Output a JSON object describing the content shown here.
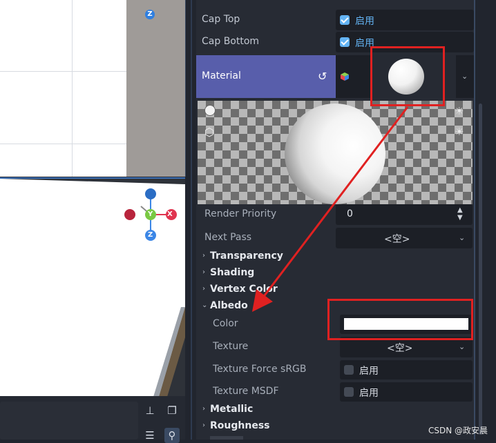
{
  "inspector": {
    "cap_top": {
      "label": "Cap Top",
      "value": "启用",
      "checked": true
    },
    "cap_bottom": {
      "label": "Cap Bottom",
      "value": "启用",
      "checked": true
    },
    "material": {
      "label": "Material",
      "reset_icon": "reset-icon",
      "type_icon": "cube-icon"
    },
    "render_priority": {
      "label": "Render Priority",
      "value": "0"
    },
    "next_pass": {
      "label": "Next Pass",
      "value": "<空>"
    },
    "sections": {
      "transparency": "Transparency",
      "shading": "Shading",
      "vertex_color": "Vertex Color",
      "albedo": "Albedo",
      "metallic": "Metallic",
      "roughness": "Roughness"
    },
    "albedo": {
      "color": {
        "label": "Color",
        "value_color": "#ffffff"
      },
      "texture": {
        "label": "Texture",
        "value": "<空>"
      },
      "texture_force_srgb": {
        "label": "Texture Force sRGB",
        "value": "启用",
        "checked": false
      },
      "texture_msdf": {
        "label": "Texture MSDF",
        "value": "启用",
        "checked": false
      }
    }
  },
  "viewport": {
    "gizmo": {
      "x": "X",
      "y": "Y",
      "z": "Z"
    }
  },
  "watermark": "CSDN @政安晨",
  "colors": {
    "accent": "#63b3f3",
    "material_row": "#585eab",
    "annotation_red": "#e02121"
  }
}
